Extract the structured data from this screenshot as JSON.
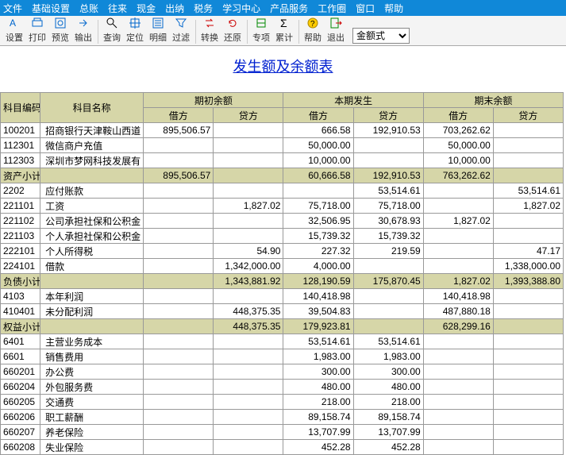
{
  "menu": [
    "文件",
    "基础设置",
    "总账",
    "往来",
    "现金",
    "出纳",
    "税务",
    "学习中心",
    "产品服务",
    "工作圈",
    "窗口",
    "帮助"
  ],
  "toolbar": {
    "items": [
      {
        "name": "set-icon",
        "label": "设置"
      },
      {
        "name": "print-icon",
        "label": "打印"
      },
      {
        "name": "preview-icon",
        "label": "预览"
      },
      {
        "name": "export-icon",
        "label": "输出"
      },
      {
        "sep": true
      },
      {
        "name": "search-icon",
        "label": "查询"
      },
      {
        "name": "locate-icon",
        "label": "定位"
      },
      {
        "name": "detail-icon",
        "label": "明细"
      },
      {
        "name": "filter-icon",
        "label": "过滤"
      },
      {
        "sep": true
      },
      {
        "name": "convert-icon",
        "label": "转换"
      },
      {
        "name": "restore-icon",
        "label": "还原"
      },
      {
        "sep": true
      },
      {
        "name": "special-icon",
        "label": "专项"
      },
      {
        "name": "sum-icon",
        "label": "累计"
      },
      {
        "sep": true
      },
      {
        "name": "help-icon",
        "label": "帮助"
      },
      {
        "name": "exit-icon",
        "label": "退出"
      }
    ],
    "combo_value": "金额式"
  },
  "title": "发生额及余额表",
  "headers": {
    "code": "科目编码",
    "name": "科目名称",
    "opening": "期初余额",
    "current": "本期发生",
    "closing": "期末余额",
    "debit": "借方",
    "credit": "贷方"
  },
  "rows": [
    {
      "code": "100201",
      "name": "招商银行天津鞍山西道",
      "od": "895,506.57",
      "oc": "",
      "cd": "666.58",
      "cc": "192,910.53",
      "ed": "703,262.62",
      "ec": ""
    },
    {
      "code": "112301",
      "name": "微信商户充值",
      "od": "",
      "oc": "",
      "cd": "50,000.00",
      "cc": "",
      "ed": "50,000.00",
      "ec": ""
    },
    {
      "code": "112303",
      "name": "深圳市梦网科技发展有",
      "od": "",
      "oc": "",
      "cd": "10,000.00",
      "cc": "",
      "ed": "10,000.00",
      "ec": ""
    },
    {
      "sub": true,
      "code": "资产小计",
      "name": "",
      "od": "895,506.57",
      "oc": "",
      "cd": "60,666.58",
      "cc": "192,910.53",
      "ed": "763,262.62",
      "ec": ""
    },
    {
      "code": "2202",
      "name": "应付账款",
      "od": "",
      "oc": "",
      "cd": "",
      "cc": "53,514.61",
      "ed": "",
      "ec": "53,514.61"
    },
    {
      "code": "221101",
      "name": "工资",
      "od": "",
      "oc": "1,827.02",
      "cd": "75,718.00",
      "cc": "75,718.00",
      "ed": "",
      "ec": "1,827.02"
    },
    {
      "code": "221102",
      "name": "公司承担社保和公积金",
      "od": "",
      "oc": "",
      "cd": "32,506.95",
      "cc": "30,678.93",
      "ed": "1,827.02",
      "ec": ""
    },
    {
      "code": "221103",
      "name": "个人承担社保和公积金",
      "od": "",
      "oc": "",
      "cd": "15,739.32",
      "cc": "15,739.32",
      "ed": "",
      "ec": ""
    },
    {
      "code": "222101",
      "name": "个人所得税",
      "od": "",
      "oc": "54.90",
      "cd": "227.32",
      "cc": "219.59",
      "ed": "",
      "ec": "47.17"
    },
    {
      "code": "224101",
      "name": "借款",
      "od": "",
      "oc": "1,342,000.00",
      "cd": "4,000.00",
      "cc": "",
      "ed": "",
      "ec": "1,338,000.00"
    },
    {
      "sub": true,
      "code": "负债小计",
      "name": "",
      "od": "",
      "oc": "1,343,881.92",
      "cd": "128,190.59",
      "cc": "175,870.45",
      "ed": "1,827.02",
      "ec": "1,393,388.80"
    },
    {
      "code": "4103",
      "name": "本年利润",
      "od": "",
      "oc": "",
      "cd": "140,418.98",
      "cc": "",
      "ed": "140,418.98",
      "ec": ""
    },
    {
      "code": "410401",
      "name": "未分配利润",
      "od": "",
      "oc": "448,375.35",
      "cd": "39,504.83",
      "cc": "",
      "ed": "487,880.18",
      "ec": ""
    },
    {
      "sub": true,
      "code": "权益小计",
      "name": "",
      "od": "",
      "oc": "448,375.35",
      "cd": "179,923.81",
      "cc": "",
      "ed": "628,299.16",
      "ec": ""
    },
    {
      "code": "6401",
      "name": "主营业务成本",
      "od": "",
      "oc": "",
      "cd": "53,514.61",
      "cc": "53,514.61",
      "ed": "",
      "ec": ""
    },
    {
      "code": "6601",
      "name": "销售费用",
      "od": "",
      "oc": "",
      "cd": "1,983.00",
      "cc": "1,983.00",
      "ed": "",
      "ec": ""
    },
    {
      "code": "660201",
      "name": "办公费",
      "od": "",
      "oc": "",
      "cd": "300.00",
      "cc": "300.00",
      "ed": "",
      "ec": ""
    },
    {
      "code": "660204",
      "name": "外包服务费",
      "od": "",
      "oc": "",
      "cd": "480.00",
      "cc": "480.00",
      "ed": "",
      "ec": ""
    },
    {
      "code": "660205",
      "name": "交通费",
      "od": "",
      "oc": "",
      "cd": "218.00",
      "cc": "218.00",
      "ed": "",
      "ec": ""
    },
    {
      "code": "660206",
      "name": "职工薪酬",
      "od": "",
      "oc": "",
      "cd": "89,158.74",
      "cc": "89,158.74",
      "ed": "",
      "ec": ""
    },
    {
      "code": "660207",
      "name": "养老保险",
      "od": "",
      "oc": "",
      "cd": "13,707.99",
      "cc": "13,707.99",
      "ed": "",
      "ec": ""
    },
    {
      "code": "660208",
      "name": "失业保险",
      "od": "",
      "oc": "",
      "cd": "452.28",
      "cc": "452.28",
      "ed": "",
      "ec": ""
    }
  ]
}
